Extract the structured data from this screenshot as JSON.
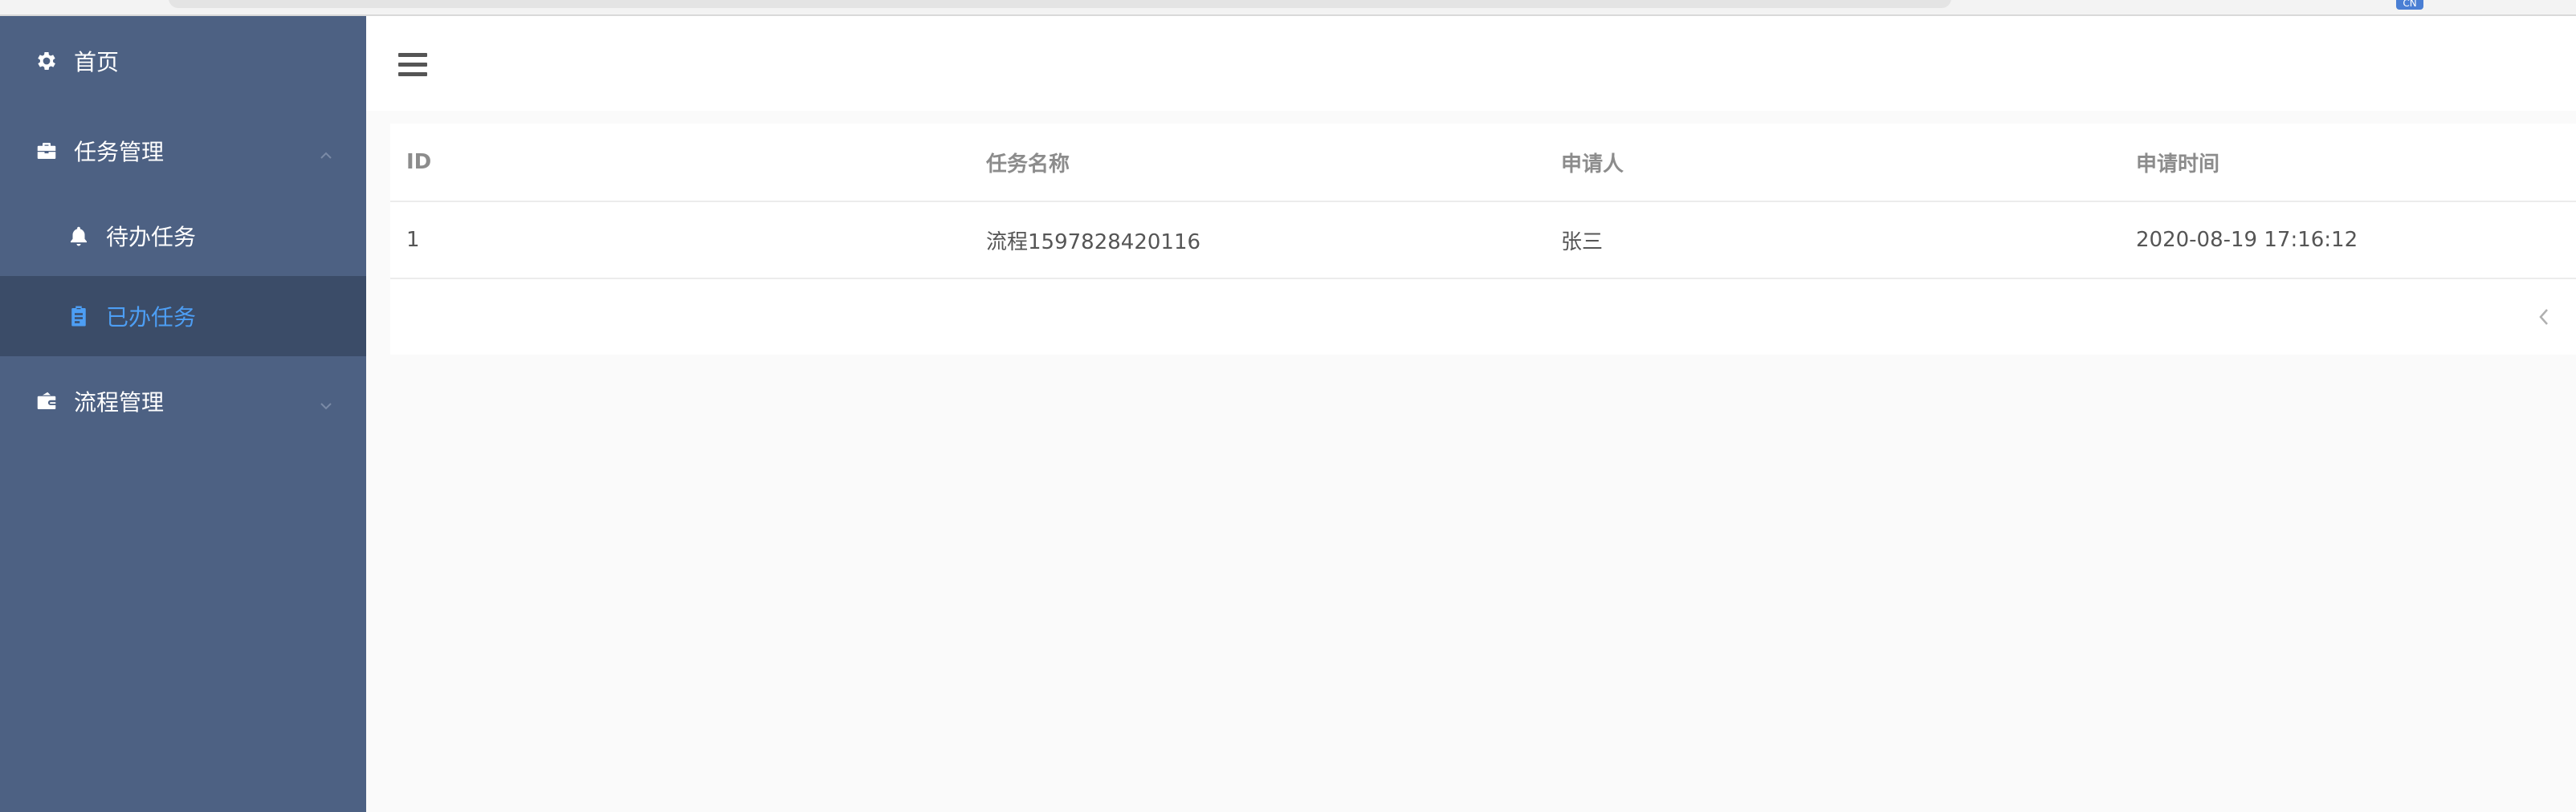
{
  "browser": {
    "badge": "CN"
  },
  "sidebar": {
    "items": [
      {
        "label": "首页",
        "icon": "gear-icon"
      },
      {
        "label": "任务管理",
        "icon": "briefcase-icon",
        "expanded": true
      },
      {
        "label": "待办任务",
        "icon": "bell-icon"
      },
      {
        "label": "已办任务",
        "icon": "clipboard-icon",
        "active": true
      },
      {
        "label": "流程管理",
        "icon": "wallet-icon",
        "expanded": false
      }
    ]
  },
  "colors": {
    "sidebar_bg": "#4d6183",
    "sidebar_active_bg": "#3b4c68",
    "active_text": "#4d9ef4"
  },
  "table": {
    "columns": [
      "ID",
      "任务名称",
      "申请人",
      "申请时间"
    ],
    "rows": [
      [
        "1",
        "流程1597828420116",
        "张三",
        "2020-08-19 17:16:12"
      ]
    ]
  }
}
